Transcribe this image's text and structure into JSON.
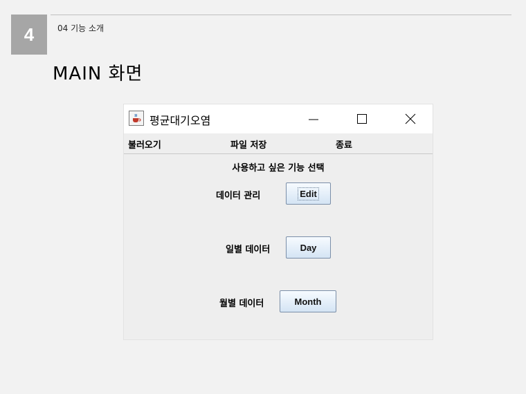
{
  "slide": {
    "number": "4",
    "section": "04 기능 소개",
    "title": "MAIN 화면"
  },
  "window": {
    "title": "평균대기오염",
    "icon": "java-cup-icon",
    "controls": [
      "minimize-icon",
      "maximize-icon",
      "close-icon"
    ]
  },
  "menu": {
    "items": [
      "불러오기",
      "파일 저장",
      "종료"
    ]
  },
  "content": {
    "prompt": "사용하고 싶은 기능 선택",
    "rows": [
      {
        "label": "데이터 관리",
        "button": "Edit"
      },
      {
        "label": "일별 데이터",
        "button": "Day"
      },
      {
        "label": "월별 데이터",
        "button": "Month"
      }
    ]
  }
}
